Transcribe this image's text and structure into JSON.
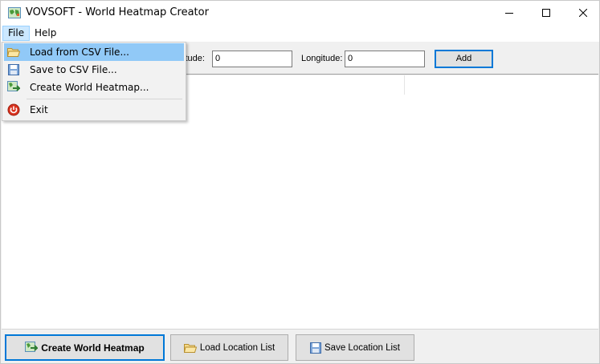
{
  "window": {
    "title": "VOVSOFT - World Heatmap Creator",
    "controls": {
      "minimize": "minimize-icon",
      "maximize": "maximize-icon",
      "close": "close-icon"
    }
  },
  "menubar": {
    "file": "File",
    "help": "Help"
  },
  "file_menu": {
    "items": [
      {
        "label": "Load from CSV File...",
        "icon": "open-folder-icon"
      },
      {
        "label": "Save to CSV File...",
        "icon": "save-disk-icon"
      },
      {
        "label": "Create World Heatmap...",
        "icon": "heatmap-icon"
      },
      {
        "label": "Exit",
        "icon": "power-icon"
      }
    ]
  },
  "toolbar": {
    "latitude_label": "itude:",
    "latitude_value": "0",
    "longitude_label": "Longitude:",
    "longitude_value": "0",
    "add_label": "Add"
  },
  "bottom": {
    "create_label": "Create World Heatmap",
    "load_label": "Load Location List",
    "save_label": "Save Location List"
  },
  "colors": {
    "accent": "#0078d7",
    "menu_highlight": "#91c9f7",
    "file_menu_active": "#cce8ff"
  }
}
